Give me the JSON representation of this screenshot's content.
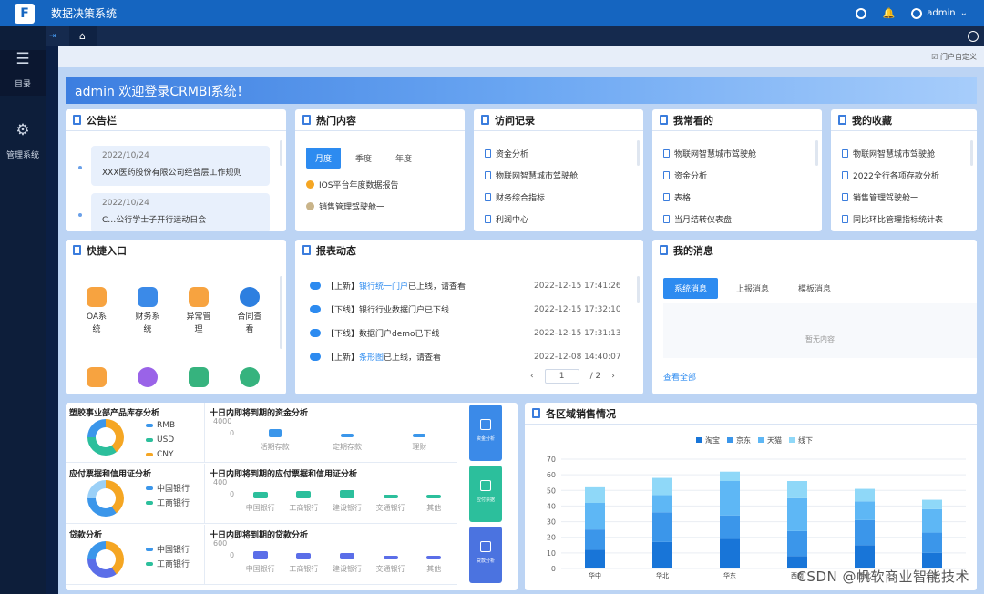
{
  "app": {
    "title": "数据决策系统",
    "user": "admin"
  },
  "sidebar": {
    "items": [
      {
        "label": "目录",
        "icon": "list-icon"
      },
      {
        "label": "管理系统",
        "icon": "gear-icon"
      }
    ]
  },
  "portal": {
    "customize": "门户自定义"
  },
  "banner": {
    "text": "admin 欢迎登录CRMBI系统！"
  },
  "notice": {
    "title": "公告栏",
    "items": [
      {
        "date": "2022/10/24",
        "text": "XXX医药股份有限公司经营层工作规则"
      },
      {
        "date": "2022/10/24",
        "text": "C…公行学士子开行运动日会"
      }
    ]
  },
  "hot": {
    "title": "热门内容",
    "tabs": [
      "月度",
      "季度",
      "年度"
    ],
    "items": [
      "IOS平台年度数据报告",
      "销售管理驾驶舱一"
    ]
  },
  "visits": {
    "title": "访问记录",
    "items": [
      "资金分析",
      "物联网智慧城市驾驶舱",
      "财务综合指标",
      "利润中心"
    ]
  },
  "frequent": {
    "title": "我常看的",
    "items": [
      "物联网智慧城市驾驶舱",
      "资金分析",
      "表格",
      "当月结转仪表盘"
    ]
  },
  "favorites": {
    "title": "我的收藏",
    "items": [
      "物联网智慧城市驾驶舱",
      "2022全行各项存款分析",
      "销售管理驾驶舱一",
      "同比环比管理指标统计表"
    ]
  },
  "quick": {
    "title": "快捷入口",
    "items": [
      {
        "l1": "OA系",
        "l2": "统"
      },
      {
        "l1": "财务系",
        "l2": "统"
      },
      {
        "l1": "异常管",
        "l2": "理"
      },
      {
        "l1": "合同查",
        "l2": "看"
      }
    ]
  },
  "reports": {
    "title": "报表动态",
    "items": [
      {
        "tag": "【上新】",
        "link": "银行统一门户",
        "rest": "已上线，请查看",
        "time": "2022-12-15 17:41:26"
      },
      {
        "tag": "【下线】",
        "link": "",
        "rest": "银行行业数据门户已下线",
        "time": "2022-12-15 17:32:10"
      },
      {
        "tag": "【下线】",
        "link": "",
        "rest": "数据门户demo已下线",
        "time": "2022-12-15 17:31:13"
      },
      {
        "tag": "【上新】",
        "link": "条形图",
        "rest": "已上线，请查看",
        "time": "2022-12-08 14:40:07"
      }
    ],
    "pager": {
      "current": "1",
      "total": "/ 2"
    }
  },
  "messages": {
    "title": "我的消息",
    "tabs": [
      "系统消息",
      "上报消息",
      "模板消息"
    ],
    "empty": "暂无内容",
    "view_all": "查看全部"
  },
  "bottom": {
    "rows": [
      {
        "left_title": "塑胶事业部产品库存分析",
        "legend": [
          "RMB",
          "USD",
          "CNY"
        ],
        "right_title": "十日内即将到期的资金分析",
        "ymax": "4000",
        "ymin": "0",
        "cats": [
          "活期存款",
          "定期存款",
          "理财"
        ],
        "values": [
          2600,
          900,
          600
        ]
      },
      {
        "left_title": "应付票据和信用证分析",
        "legend": [
          "中国银行",
          "工商银行"
        ],
        "right_title": "十日内即将到期的应付票据和信用证分析",
        "ymax": "400",
        "ymin": "0",
        "cats": [
          "中国银行",
          "工商银行",
          "建设银行",
          "交通银行",
          "其他"
        ],
        "values": [
          210,
          220,
          260,
          120,
          110
        ]
      },
      {
        "left_title": "贷款分析",
        "legend": [
          "中国银行",
          "工商银行"
        ],
        "right_title": "十日内即将到期的贷款分析",
        "ymax": "600",
        "ymin": "0",
        "cats": [
          "中国银行",
          "工商银行",
          "建设银行",
          "交通银行",
          "其他"
        ],
        "values": [
          400,
          300,
          290,
          120,
          110
        ]
      }
    ],
    "buttons": [
      "资金分析",
      "应付票据",
      "贷款分析"
    ]
  },
  "chart_data": {
    "type": "bar",
    "title": "各区域销售情况",
    "categories": [
      "华中",
      "华北",
      "华东",
      "西南",
      "西北",
      "东北"
    ],
    "series": [
      {
        "name": "淘宝",
        "values": [
          12,
          17,
          19,
          8,
          15,
          10
        ]
      },
      {
        "name": "京东",
        "values": [
          13,
          19,
          15,
          16,
          16,
          13
        ]
      },
      {
        "name": "天猫",
        "values": [
          17,
          11,
          22,
          21,
          12,
          15
        ]
      },
      {
        "name": "线下",
        "values": [
          10,
          11,
          6,
          11,
          8,
          6
        ]
      }
    ],
    "colors": [
      "#1875d8",
      "#3b96ea",
      "#5eb7f5",
      "#8fd8f8"
    ],
    "yticks": [
      "0",
      "10",
      "20",
      "30",
      "40",
      "50",
      "60",
      "70"
    ],
    "ylim": [
      0,
      70
    ]
  },
  "watermark": "CSDN @帆软商业智能技术"
}
